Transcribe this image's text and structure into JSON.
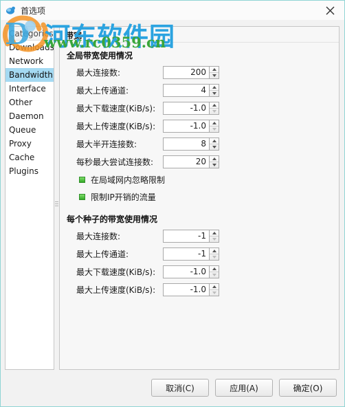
{
  "window": {
    "title": "首选项",
    "icon": "droplet-icon",
    "close_label": "×",
    "border_color": "#8fd4d4"
  },
  "sidebar": {
    "header": "Categories",
    "selected": "Bandwidth",
    "selected_color": "#a4d9f2",
    "items": [
      {
        "label": "Downloads"
      },
      {
        "label": "Network"
      },
      {
        "label": "Bandwidth"
      },
      {
        "label": "Interface"
      },
      {
        "label": "Other"
      },
      {
        "label": "Daemon"
      },
      {
        "label": "Queue"
      },
      {
        "label": "Proxy"
      },
      {
        "label": "Cache"
      },
      {
        "label": "Plugins"
      }
    ]
  },
  "panel": {
    "title": "带宽",
    "groups": [
      {
        "title": "全局带宽使用情况",
        "rows": [
          {
            "label": "最大连接数:",
            "value": "200",
            "down_enabled": true
          },
          {
            "label": "最大上传通道:",
            "value": "4",
            "down_enabled": true
          },
          {
            "label": "最大下载速度(KiB/s):",
            "value": "-1.0",
            "down_enabled": false
          },
          {
            "label": "最大上传速度(KiB/s):",
            "value": "-1.0",
            "down_enabled": false
          },
          {
            "label": "最大半开连接数:",
            "value": "8",
            "down_enabled": true
          },
          {
            "label": "每秒最大尝试连接数:",
            "value": "20",
            "down_enabled": true
          }
        ],
        "checkboxes": [
          {
            "label": "在局域网内忽略限制",
            "checked": true
          },
          {
            "label": "限制IP开销的流量",
            "checked": true
          }
        ]
      },
      {
        "title": "每个种子的带宽使用情况",
        "rows": [
          {
            "label": "最大连接数:",
            "value": "-1",
            "down_enabled": false
          },
          {
            "label": "最大上传通道:",
            "value": "-1",
            "down_enabled": false
          },
          {
            "label": "最大下载速度(KiB/s):",
            "value": "-1.0",
            "down_enabled": false
          },
          {
            "label": "最大上传速度(KiB/s):",
            "value": "-1.0",
            "down_enabled": false
          }
        ],
        "checkboxes": []
      }
    ]
  },
  "footer": {
    "buttons": [
      {
        "label": "取消(C)",
        "name": "cancel-button"
      },
      {
        "label": "应用(A)",
        "name": "apply-button"
      },
      {
        "label": "确定(O)",
        "name": "ok-button"
      }
    ]
  },
  "watermark": {
    "site_name": "河东软件园",
    "url": "www.rc0359.cn",
    "site_color": "#2ba3e0",
    "url_color": "#3aa63a"
  }
}
